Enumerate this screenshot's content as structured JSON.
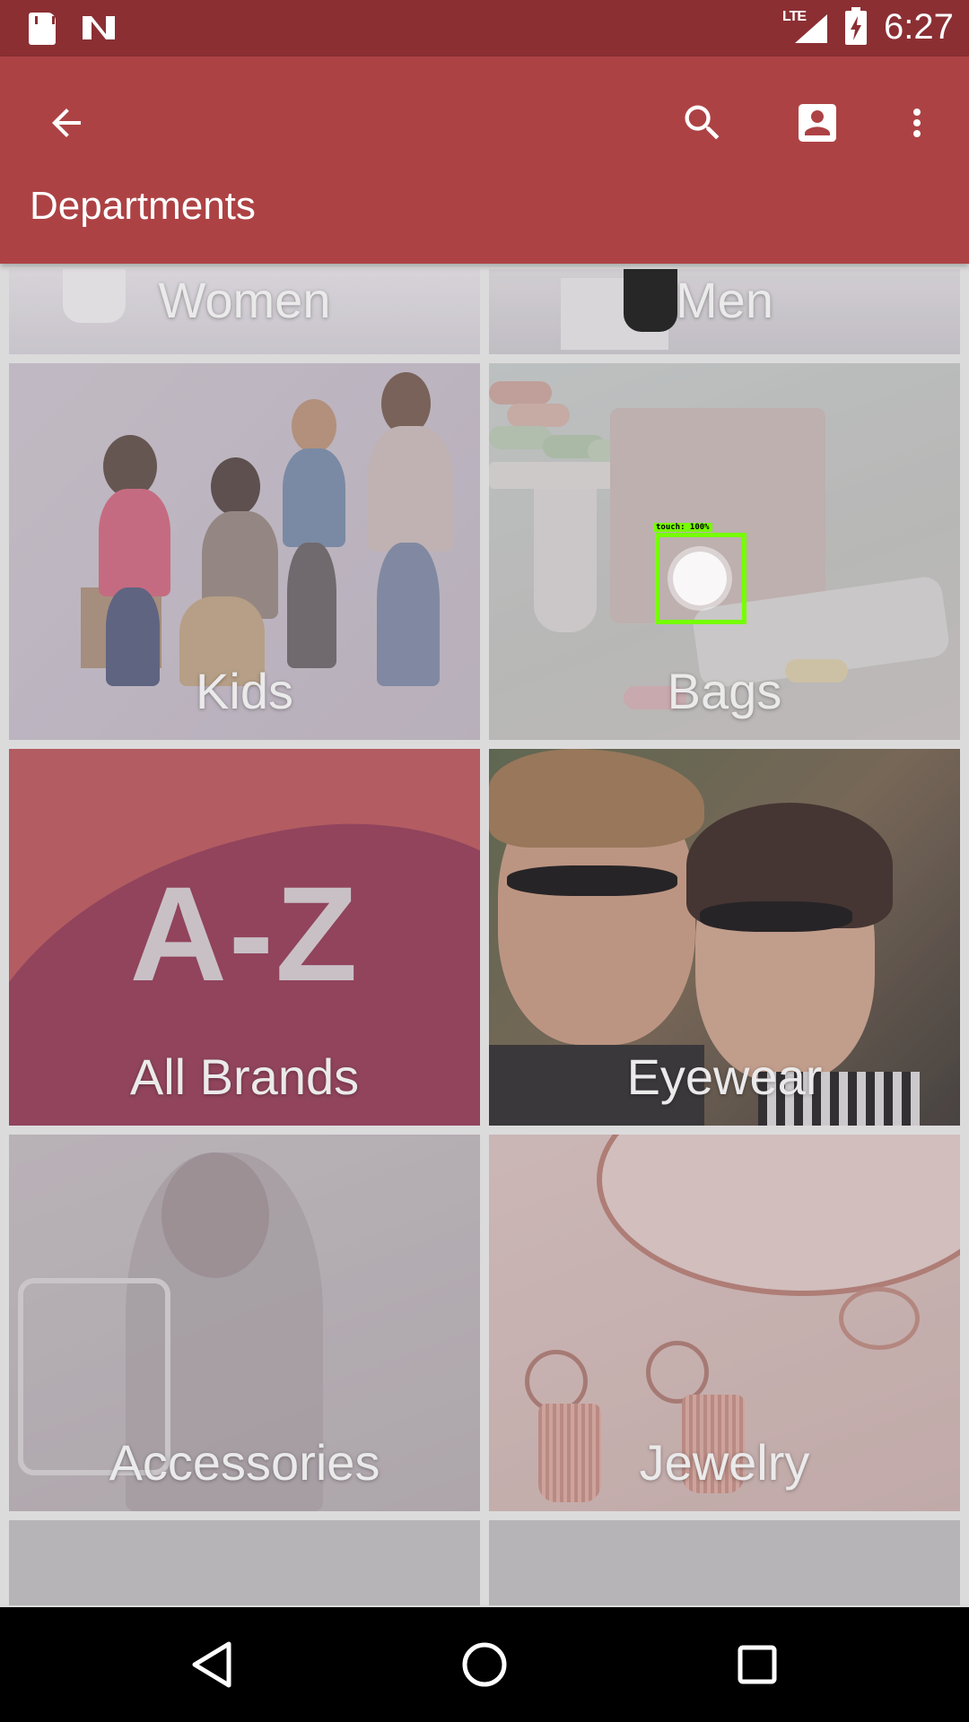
{
  "status_bar": {
    "network": "LTE",
    "time": "6:27"
  },
  "app_bar": {
    "title": "Departments",
    "icons": [
      "arrow-back-icon",
      "search-icon",
      "account-box-icon",
      "more-vert-icon"
    ]
  },
  "departments": [
    {
      "label": "Women"
    },
    {
      "label": "Men"
    },
    {
      "label": "Kids"
    },
    {
      "label": "Bags"
    },
    {
      "label": "All Brands",
      "art_text": "A-Z"
    },
    {
      "label": "Eyewear"
    },
    {
      "label": "Accessories"
    },
    {
      "label": "Jewelry"
    }
  ],
  "touch_indicator": {
    "label": "touch: 100%"
  },
  "colors": {
    "status_bar": "#8b2f33",
    "app_bar": "#ad4244",
    "background": "#eeeeee",
    "touch": "#76ff03"
  }
}
